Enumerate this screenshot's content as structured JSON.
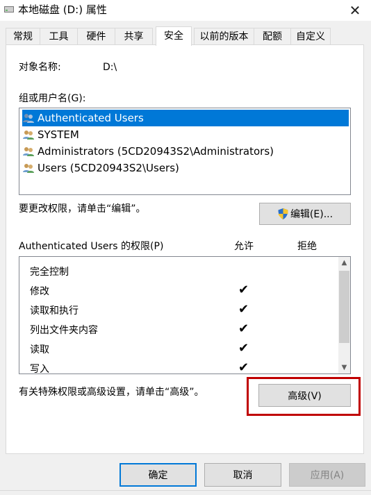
{
  "window": {
    "title": "本地磁盘 (D:) 属性",
    "close_glyph": "✕"
  },
  "tabs": [
    {
      "label": "常规"
    },
    {
      "label": "工具"
    },
    {
      "label": "硬件"
    },
    {
      "label": "共享"
    },
    {
      "label": "安全",
      "active": true
    },
    {
      "label": "以前的版本"
    },
    {
      "label": "配额"
    },
    {
      "label": "自定义"
    }
  ],
  "security": {
    "object_name_label": "对象名称:",
    "object_name_value": "D:\\",
    "group_label": "组或用户名(G):",
    "users": [
      {
        "name": "Authenticated Users",
        "selected": true
      },
      {
        "name": "SYSTEM"
      },
      {
        "name": "Administrators (5CD20943S2\\Administrators)"
      },
      {
        "name": "Users (5CD20943S2\\Users)"
      }
    ],
    "edit_hint": "要更改权限，请单击“编辑”。",
    "edit_button": "编辑(E)...",
    "permissions_label": "Authenticated Users 的权限(P)",
    "allow_header": "允许",
    "deny_header": "拒绝",
    "permissions": [
      {
        "name": "完全控制",
        "allow": false
      },
      {
        "name": "修改",
        "allow": true
      },
      {
        "name": "读取和执行",
        "allow": true
      },
      {
        "name": "列出文件夹内容",
        "allow": true
      },
      {
        "name": "读取",
        "allow": true
      },
      {
        "name": "写入",
        "allow": true
      }
    ],
    "check_glyph": "✔",
    "advanced_hint": "有关特殊权限或高级设置，请单击“高级”。",
    "advanced_button": "高级(V)"
  },
  "footer": {
    "ok": "确定",
    "cancel": "取消",
    "apply": "应用(A)"
  },
  "colors": {
    "selection": "#0078d7",
    "highlight_box": "#c00000"
  }
}
